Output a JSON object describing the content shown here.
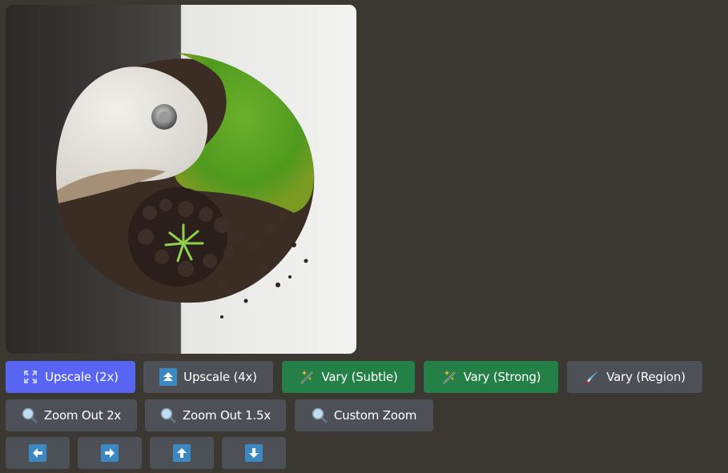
{
  "generated_image": {
    "alt": "Yin-yang sculpture made of white disc, soil, rocks, moss and a small green plant on a half-dark half-white background"
  },
  "actions": {
    "row1": [
      {
        "label": "Upscale (2x)",
        "icon": "expand-arrows-icon",
        "style": "primary"
      },
      {
        "label": "Upscale (4x)",
        "icon": "double-up-arrow-icon",
        "style": "secondary"
      },
      {
        "label": "Vary (Subtle)",
        "icon": "magic-wand-icon",
        "style": "success"
      },
      {
        "label": "Vary (Strong)",
        "icon": "magic-wand-icon",
        "style": "success"
      },
      {
        "label": "Vary (Region)",
        "icon": "paintbrush-icon",
        "style": "secondary"
      }
    ],
    "row2": [
      {
        "label": "Zoom Out 2x",
        "icon": "magnifier-icon"
      },
      {
        "label": "Zoom Out 1.5x",
        "icon": "magnifier-icon"
      },
      {
        "label": "Custom Zoom",
        "icon": "magnifier-icon"
      }
    ],
    "row3": [
      {
        "label": "Pan Left",
        "icon": "arrow-left-icon"
      },
      {
        "label": "Pan Right",
        "icon": "arrow-right-icon"
      },
      {
        "label": "Pan Up",
        "icon": "arrow-up-icon"
      },
      {
        "label": "Pan Down",
        "icon": "arrow-down-icon"
      }
    ]
  },
  "colors": {
    "background": "#3b3731",
    "primary": "#5865f2",
    "secondary": "#4e5058",
    "success": "#248046",
    "arrow_icon": "#3b88c3"
  }
}
